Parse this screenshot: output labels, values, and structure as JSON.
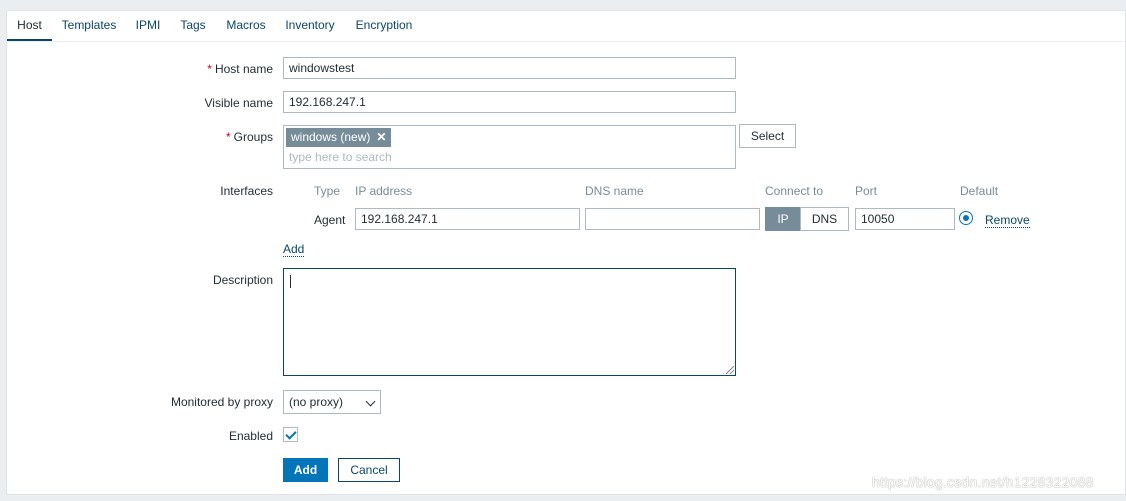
{
  "tabs": [
    {
      "label": "Host"
    },
    {
      "label": "Templates"
    },
    {
      "label": "IPMI"
    },
    {
      "label": "Tags"
    },
    {
      "label": "Macros"
    },
    {
      "label": "Inventory"
    },
    {
      "label": "Encryption"
    }
  ],
  "form": {
    "host_name": {
      "label": "Host name",
      "required_mark": "*",
      "value": "windowstest"
    },
    "visible_name": {
      "label": "Visible name",
      "value": "192.168.247.1"
    },
    "groups": {
      "label": "Groups",
      "required_mark": "*",
      "chip": "windows (new)",
      "chip_remove": "✕",
      "placeholder": "type here to search",
      "select_label": "Select"
    },
    "interfaces": {
      "label": "Interfaces",
      "columns": {
        "type": "Type",
        "ip": "IP address",
        "dns": "DNS name",
        "connect": "Connect to",
        "port": "Port",
        "default": "Default"
      },
      "row": {
        "type": "Agent",
        "ip": "192.168.247.1",
        "dns": "",
        "connect_ip": "IP",
        "connect_dns": "DNS",
        "port": "10050",
        "remove": "Remove"
      },
      "add": "Add"
    },
    "description": {
      "label": "Description",
      "value": ""
    },
    "proxy": {
      "label": "Monitored by proxy",
      "value": "(no proxy)"
    },
    "enabled": {
      "label": "Enabled",
      "checked": true
    },
    "buttons": {
      "add": "Add",
      "cancel": "Cancel"
    }
  },
  "watermark": "https://blog.csdn.net/h1228322088",
  "colors": {
    "accent": "#0275b8",
    "link": "#0a466a",
    "chip": "#768d99",
    "required": "#d40000"
  }
}
